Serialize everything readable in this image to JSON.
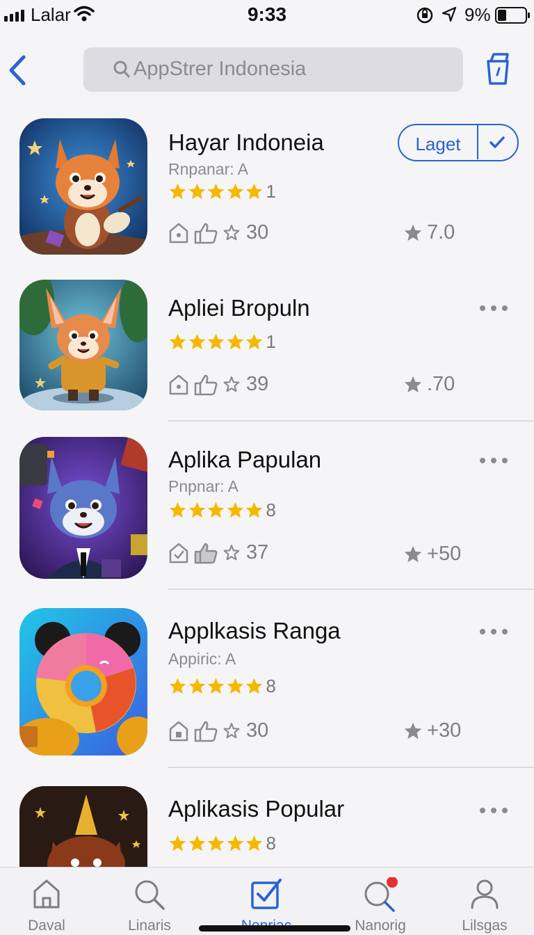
{
  "status_bar": {
    "carrier": "Lalar",
    "time": "9:33",
    "battery": "9%",
    "battery_level": 0.09
  },
  "nav": {
    "search_text": "AppStrer Indonesia",
    "back_icon": "chevron-left-icon",
    "share_icon": "share-icon"
  },
  "get_button": {
    "label": "Laget"
  },
  "apps": [
    {
      "title": "Hayar Indoneia",
      "subtitle": "Rnpanar: A",
      "rating_count": "1",
      "meta_count": "30",
      "score": "7.0",
      "score_prefix": ""
    },
    {
      "title": "Apliei Bropuln",
      "subtitle": "",
      "rating_count": "1",
      "meta_count": "39",
      "score": ".70",
      "score_prefix": ""
    },
    {
      "title": "Aplika Papulan",
      "subtitle": "Pnpnar: A",
      "rating_count": "8",
      "meta_count": "37",
      "score": "50",
      "score_prefix": "+"
    },
    {
      "title": "Applkasis Ranga",
      "subtitle": "Appiric: A",
      "rating_count": "8",
      "meta_count": "30",
      "score": "30",
      "score_prefix": "+"
    },
    {
      "title": "Aplikasis Popular",
      "subtitle": "",
      "rating_count": "8",
      "meta_count": "",
      "score": "",
      "score_prefix": ""
    }
  ],
  "tabs": [
    {
      "label": "Daval",
      "icon": "home-icon"
    },
    {
      "label": "Linaris",
      "icon": "search-icon"
    },
    {
      "label": "Nenriac",
      "icon": "checkbox-icon",
      "active": true
    },
    {
      "label": "Nanorig",
      "icon": "search-notification-icon"
    },
    {
      "label": "Lilsgas",
      "icon": "person-icon"
    }
  ],
  "colors": {
    "accent": "#2a62d4",
    "star": "#f5b800",
    "notification": "#e53030",
    "background": "#f5f5f7"
  }
}
